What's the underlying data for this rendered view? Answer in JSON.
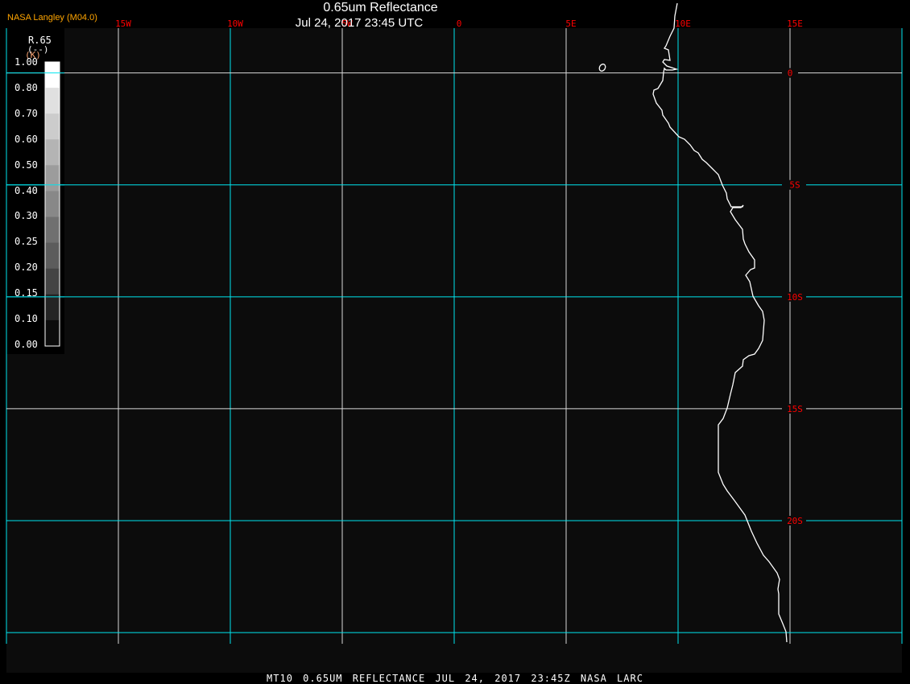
{
  "header": {
    "title": "0.65um Reflectance",
    "datetime": "Jul 24, 2017 23:45 UTC",
    "credit": "NASA Langley (M04.0)"
  },
  "footer": {
    "text": "MT10  0.65UM REFLECTANCE   JUL 24, 2017 23:45Z   NASA LARC"
  },
  "map": {
    "projection": "cylindrical",
    "lon_range": [
      -20,
      20
    ],
    "lat_range": [
      2,
      -25.5
    ],
    "lon_labels": [
      "15W",
      "10W",
      "5W",
      "0",
      "5E",
      "10E",
      "15E"
    ],
    "lat_labels": [
      "0",
      "5S",
      "10S",
      "15S",
      "20S"
    ],
    "grid_color": "#00e5ee",
    "label_color": "#ff0000",
    "coast_color": "#ffffff",
    "background": "#0c0c0c"
  },
  "colorbar": {
    "variable": "R.65",
    "unit": "(--)",
    "unit2": "(K)",
    "labels": [
      "1.00",
      "0.80",
      "0.70",
      "0.60",
      "0.50",
      "0.40",
      "0.30",
      "0.25",
      "0.20",
      "0.15",
      "0.10",
      "0.00"
    ],
    "colors": [
      "#ffffff",
      "#e0e0e0",
      "#cccccc",
      "#b4b4b4",
      "#9c9c9c",
      "#888888",
      "#707070",
      "#5c5c5c",
      "#444444",
      "#242424",
      "#0c0c0c"
    ]
  }
}
